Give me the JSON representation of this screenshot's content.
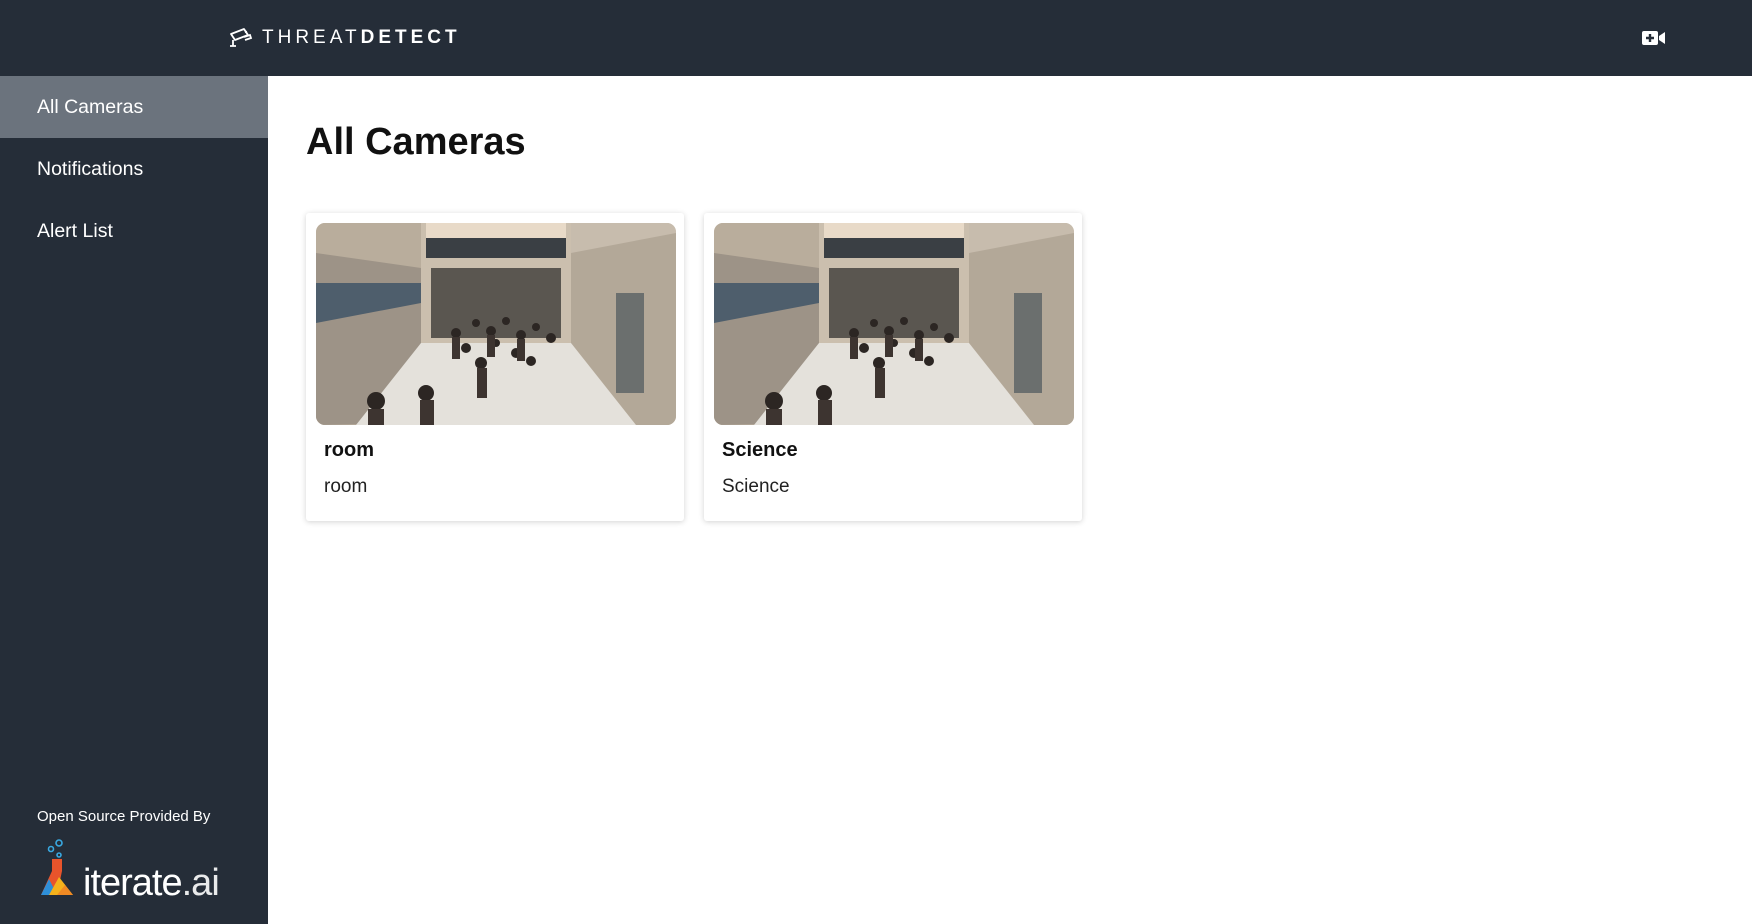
{
  "header": {
    "brand_light": "THREAT",
    "brand_bold": "DETECT",
    "brand_icon": "security-camera-icon",
    "add_camera_icon": "video-camera-plus-icon"
  },
  "sidebar": {
    "items": [
      {
        "label": "All Cameras",
        "active": true
      },
      {
        "label": "Notifications",
        "active": false
      },
      {
        "label": "Alert List",
        "active": false
      }
    ],
    "footer": {
      "text": "Open Source Provided By",
      "logo_word": "iterate",
      "logo_suffix": ".ai"
    }
  },
  "main": {
    "title": "All Cameras",
    "cameras": [
      {
        "name": "room",
        "subtitle": "room"
      },
      {
        "name": "Science",
        "subtitle": "Science"
      }
    ]
  },
  "colors": {
    "topbar": "#252d38",
    "sidebar": "#252d38",
    "active_item": "#6b737d"
  }
}
